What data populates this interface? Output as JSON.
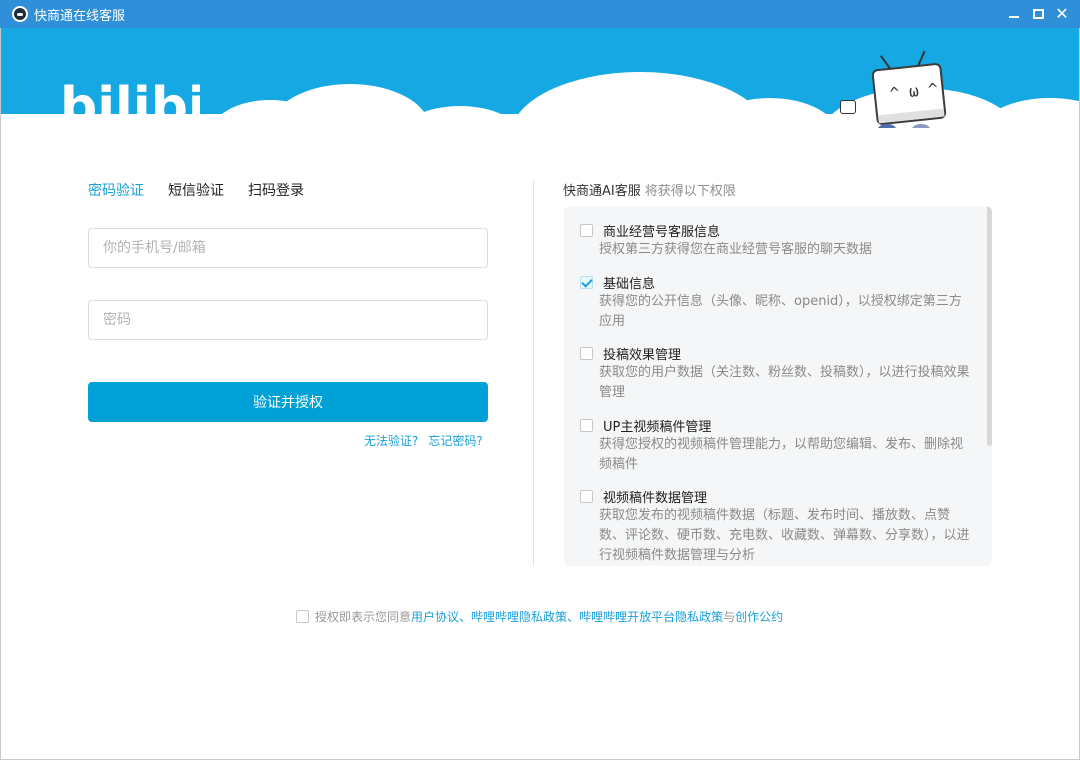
{
  "window": {
    "title": "快商通在线客服",
    "controls": {
      "minimize": "minimize",
      "maximize": "maximize",
      "close": "✕"
    }
  },
  "banner": {
    "logo_text": "bilibili",
    "mascot_face": "^ ω ^"
  },
  "login": {
    "tabs": [
      {
        "label": "密码验证",
        "active": true
      },
      {
        "label": "短信验证",
        "active": false
      },
      {
        "label": "扫码登录",
        "active": false
      }
    ],
    "account_placeholder": "你的手机号/邮箱",
    "password_placeholder": "密码",
    "submit_label": "验证并授权",
    "cannot_verify": "无法验证?",
    "forgot_password": "忘记密码?"
  },
  "permissions": {
    "app_name": "快商通AI客服",
    "header_suffix": "将获得以下权限",
    "items": [
      {
        "title": "商业经营号客服信息",
        "desc": "授权第三方获得您在商业经营号客服的聊天数据",
        "checked": false
      },
      {
        "title": "基础信息",
        "desc": "获得您的公开信息（头像、昵称、openid），以授权绑定第三方应用",
        "checked": true
      },
      {
        "title": "投稿效果管理",
        "desc": "获取您的用户数据（关注数、粉丝数、投稿数），以进行投稿效果管理",
        "checked": false
      },
      {
        "title": "UP主视频稿件管理",
        "desc": "获得您授权的视频稿件管理能力，以帮助您编辑、发布、删除视频稿件",
        "checked": false
      },
      {
        "title": "视频稿件数据管理",
        "desc": "获取您发布的视频稿件数据（标题、发布时间、播放数、点赞数、评论数、硬币数、充电数、收藏数、弹幕数、分享数），以进行视频稿件数据管理与分析",
        "checked": false
      }
    ]
  },
  "agreement": {
    "prefix": "授权即表示您同意",
    "user_agreement": "用户协议",
    "sep1": "、",
    "privacy_policy": "哔哩哔哩隐私政策",
    "sep2": "、",
    "open_platform_policy": "哔哩哔哩开放平台隐私政策",
    "and": "与",
    "creation_convention": "创作公约"
  },
  "colors": {
    "titlebar": "#2f8fd8",
    "banner": "#16a8e2",
    "accent": "#00a1d6"
  }
}
